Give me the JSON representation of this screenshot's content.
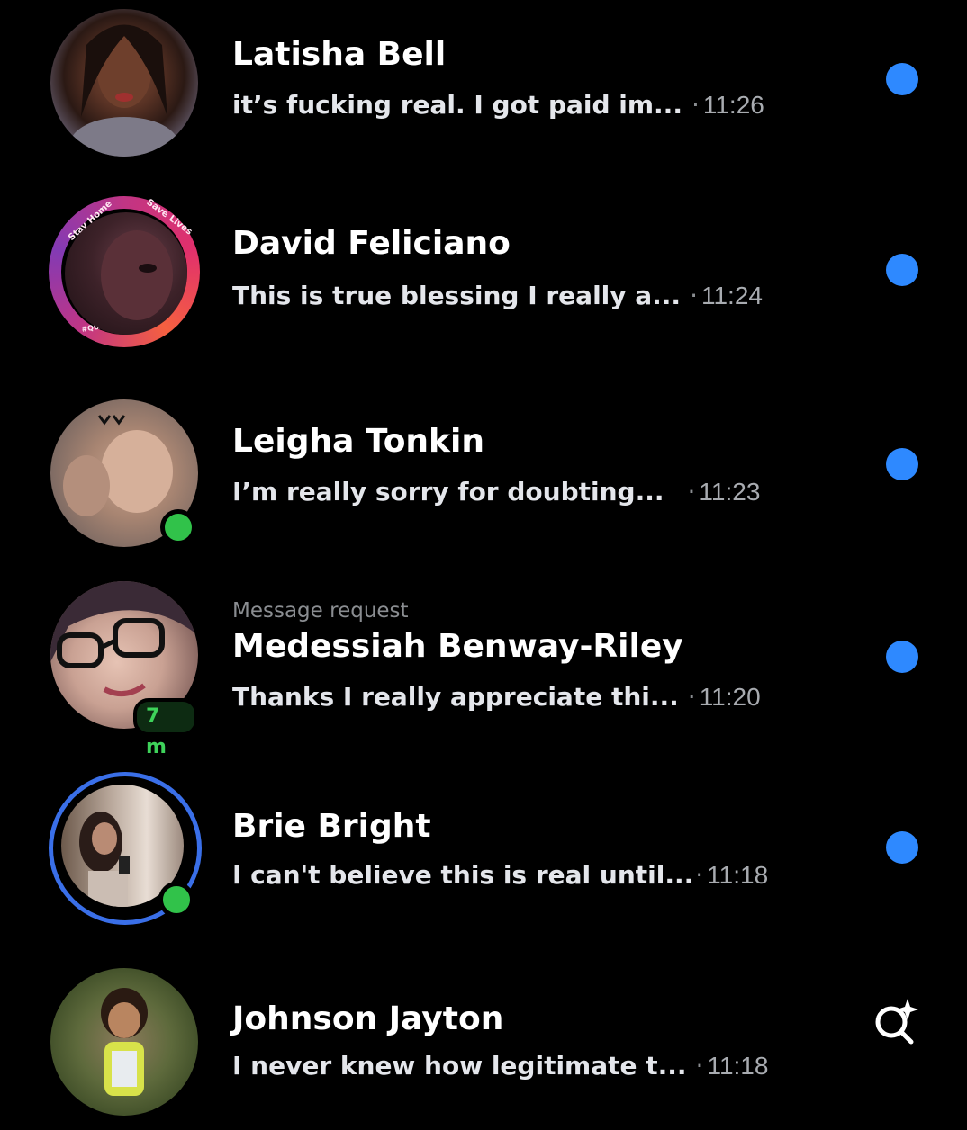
{
  "colors": {
    "background": "#000000",
    "name_text": "#ffffff",
    "preview_text": "#e4e6eb",
    "time_text": "#a8abb0",
    "unread_dot": "#2e89ff",
    "online_dot": "#31c24a",
    "story_ring_blue": "#3a6fe8"
  },
  "ring_labels": {
    "stay_home": "Stay Home",
    "save_lives": "Save Lives",
    "quaranteam": "#QUARANTEAM"
  },
  "conversations": [
    {
      "name": "Latisha Bell",
      "preview": "it’s fucking real. I got paid im...",
      "separator": "·",
      "time": "11:26",
      "unread": true
    },
    {
      "name": "David Feliciano",
      "preview": "This is true blessing I really a...",
      "separator": "·",
      "time": "11:24",
      "unread": true
    },
    {
      "name": "Leigha Tonkin",
      "preview": "I’m really sorry for doubting...",
      "separator": "·",
      "time": "11:23",
      "unread": true,
      "online": true
    },
    {
      "label": "Message request",
      "name": "Medessiah Benway-Riley",
      "preview": "Thanks I really appreciate thi...",
      "separator": "·",
      "time": "11:20",
      "unread": true,
      "active_badge": "7 m"
    },
    {
      "name": "Brie Bright",
      "preview": "I can't believe this is real until...",
      "separator": "·",
      "time": "11:18",
      "unread": true,
      "online": true
    },
    {
      "name": "Johnson Jayton",
      "preview": "I never knew how legitimate t...",
      "separator": "·",
      "time": "11:18",
      "unread": false
    }
  ],
  "fab": {
    "icon": "sparkle-search-icon"
  }
}
